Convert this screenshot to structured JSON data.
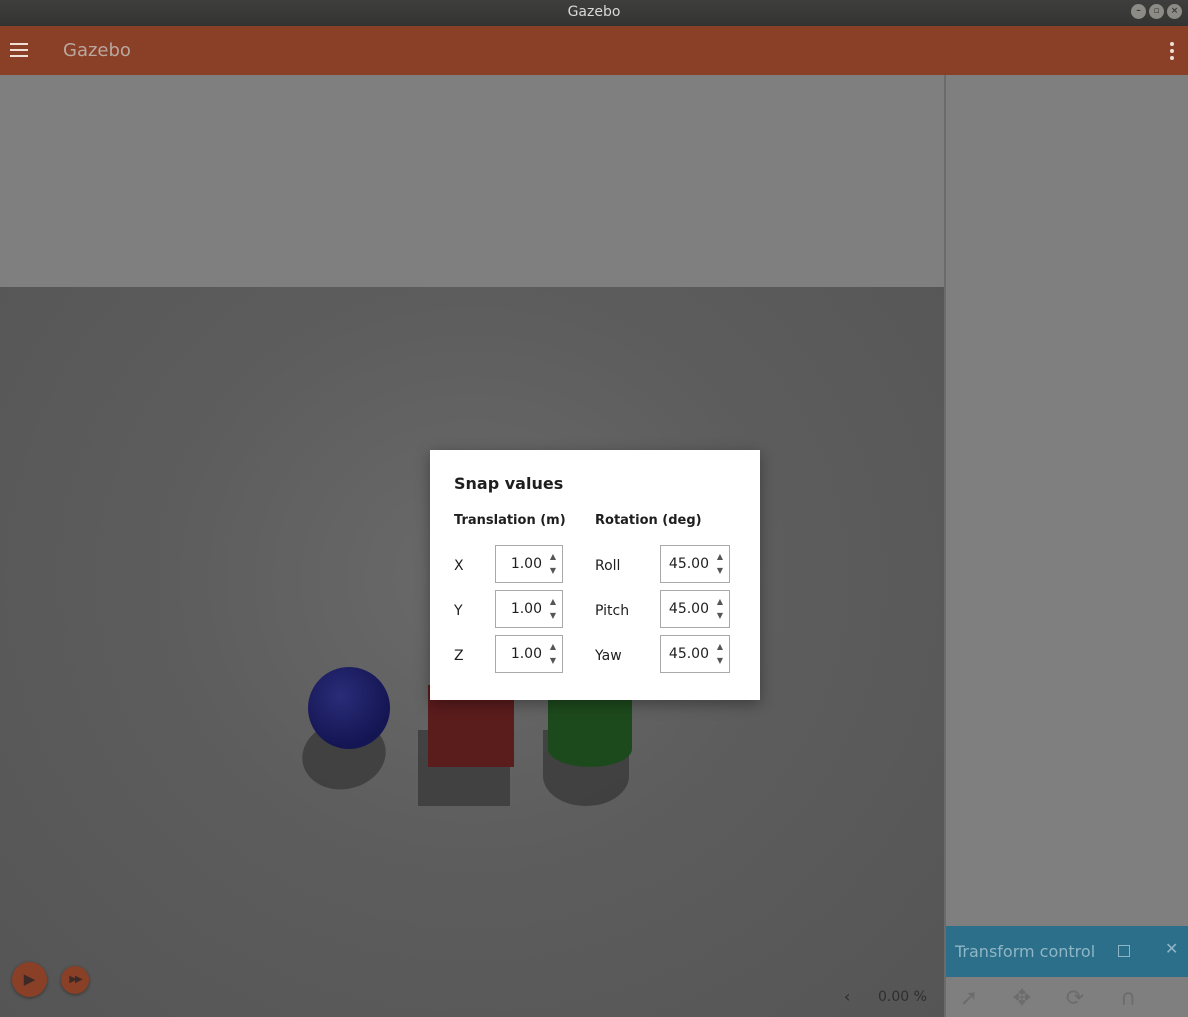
{
  "window": {
    "title": "Gazebo"
  },
  "appbar": {
    "title": "Gazebo"
  },
  "dialog": {
    "title": "Snap values",
    "translation": {
      "header": "Translation (m)",
      "rows": [
        {
          "label": "X",
          "value": "1.00"
        },
        {
          "label": "Y",
          "value": "1.00"
        },
        {
          "label": "Z",
          "value": "1.00"
        }
      ]
    },
    "rotation": {
      "header": "Rotation (deg)",
      "rows": [
        {
          "label": "Roll",
          "value": "45.00"
        },
        {
          "label": "Pitch",
          "value": "45.00"
        },
        {
          "label": "Yaw",
          "value": "45.00"
        }
      ]
    }
  },
  "transform_control": {
    "title": "Transform control",
    "tools": [
      "select-icon",
      "translate-icon",
      "rotate-icon",
      "snap-icon"
    ]
  },
  "bottom_bar": {
    "rtf": "0.00 %"
  },
  "colors": {
    "appbar": "#8a3f27",
    "panel_header": "#2b6f8a",
    "sphere": "#1b1c66",
    "box": "#5b1c1c",
    "cylinder": "#1d4a1d"
  }
}
